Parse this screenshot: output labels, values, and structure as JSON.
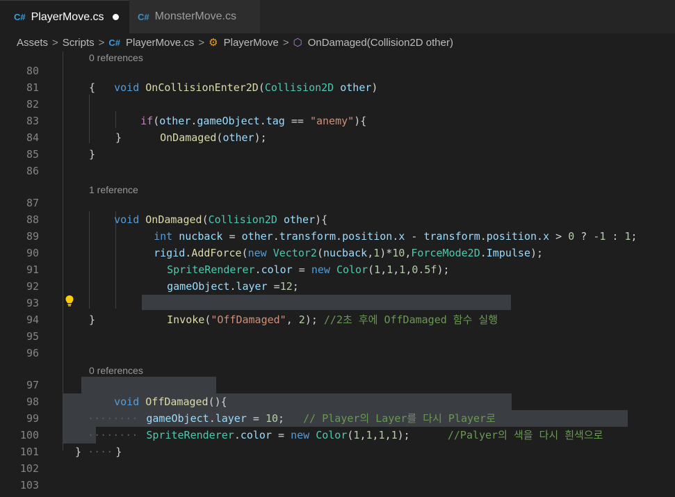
{
  "tabs": [
    {
      "label": "PlayerMove.cs",
      "icon": "csharp-file-icon",
      "active": true,
      "dirty": true
    },
    {
      "label": "MonsterMove.cs",
      "icon": "csharp-file-icon",
      "active": false
    }
  ],
  "breadcrumb": {
    "assets": "Assets",
    "scripts": "Scripts",
    "file": "PlayerMove.cs",
    "class": "PlayerMove",
    "method": "OnDamaged(Collision2D other)"
  },
  "lens": {
    "l80": "0 references",
    "l87": "1 reference",
    "l97": "0 references"
  },
  "line_numbers": [
    "80",
    "81",
    "82",
    "83",
    "84",
    "85",
    "86",
    "87",
    "88",
    "89",
    "90",
    "91",
    "92",
    "93",
    "94",
    "95",
    "96",
    "97",
    "98",
    "99",
    "100",
    "101",
    "102",
    "103"
  ],
  "code": {
    "l80": {
      "kw": "void",
      "fn": "OnCollisionEnter2D",
      "p1": "(",
      "ty": "Collision2D",
      "sp": " ",
      "id": "other",
      "p2": ")"
    },
    "l81": "{",
    "l82": {
      "ctl": "if",
      "p1": "(",
      "a": "other",
      "d1": ".",
      "b": "gameObject",
      "d2": ".",
      "c": "tag",
      "op": " == ",
      "str": "\"anemy\"",
      "p2": "){"
    },
    "l83": {
      "fn": "OnDamaged",
      "p1": "(",
      "id": "other",
      "p2": ");"
    },
    "l84": "}",
    "l85": "}",
    "l87": {
      "kw": "void",
      "fn": "OnDamaged",
      "p1": "(",
      "ty": "Collision2D",
      "sp": " ",
      "id": "other",
      "p2": "){"
    },
    "l88": {
      "kw": "int",
      "a": "nucback",
      "eq": " = ",
      "b": "other",
      "d1": ".",
      "c": "transform",
      "d2": ".",
      "d": "position",
      "d3": ".",
      "e": "x",
      "mi": " - ",
      "f": "transform",
      "d4": ".",
      "g": "position",
      "d5": ".",
      "h": "x",
      "gt": " > ",
      "n0": "0",
      "q": " ? ",
      "n1": "-1",
      "co": " : ",
      "n2": "1",
      "end": ";"
    },
    "l89": {
      "a": "rigid",
      "d1": ".",
      "fn": "AddForce",
      "p1": "(",
      "kw": "new",
      "sp": " ",
      "ty": "Vector2",
      "p2": "(",
      "b": "nucback",
      "c1": ",",
      "n1": "1",
      "p3": ")*",
      "n2": "10",
      "c2": ",",
      "ty2": "ForceMode2D",
      "d2": ".",
      "c": "Impulse",
      "p4": ");"
    },
    "l90": {
      "ty": "SpriteRenderer",
      "d1": ".",
      "a": "color",
      "eq": " = ",
      "kw": "new",
      "sp": " ",
      "ty2": "Color",
      "p1": "(",
      "n1": "1",
      "c1": ",",
      "n2": "1",
      "c2": ",",
      "n3": "1",
      "c3": ",",
      "n4": "0.5f",
      "p2": ");"
    },
    "l91": {
      "a": "gameObject",
      "d1": ".",
      "b": "layer",
      "eq": " =",
      "n": "12",
      "end": ";"
    },
    "l93": {
      "fn": "Invoke",
      "p1": "(",
      "str": "\"OffDamaged\"",
      "c1": ", ",
      "n": "2",
      "p2": ");",
      "cm": " //2초 후에 OffDamaged 함수 실행"
    },
    "l94": "}",
    "l97": {
      "kw": "void",
      "fn": "OffDamaged",
      "p": "(){"
    },
    "l98": {
      "dots": "········",
      "a": "gameObject",
      "d1": ".",
      "b": "layer",
      "eq": " = ",
      "n": "10",
      "end": ";",
      "sp": "   ",
      "cm": "// Player의 Layer를 다시 Player로"
    },
    "l99": {
      "dots": "········",
      "ty": "SpriteRenderer",
      "d1": ".",
      "a": "color",
      "eq": " = ",
      "kw": "new",
      "sp": " ",
      "ty2": "Color",
      "p1": "(",
      "n1": "1",
      "c1": ",",
      "n2": "1",
      "c2": ",",
      "n3": "1",
      "c3": ",",
      "n4": "1",
      "p2": ");",
      "sp2": "      ",
      "cm": "//Palyer의 색을 다시 흰색으로"
    },
    "l100": {
      "dots": "····",
      "b": "}"
    },
    "l101": "}"
  },
  "colors": {
    "keyword": "#569cd6",
    "type": "#4ec9b0",
    "function": "#dcdcaa",
    "variable": "#9cdcfe",
    "control": "#c586c0",
    "string": "#ce9178",
    "number": "#b5cea8",
    "comment": "#6a9955",
    "lightbulb": "#ffcc00"
  }
}
